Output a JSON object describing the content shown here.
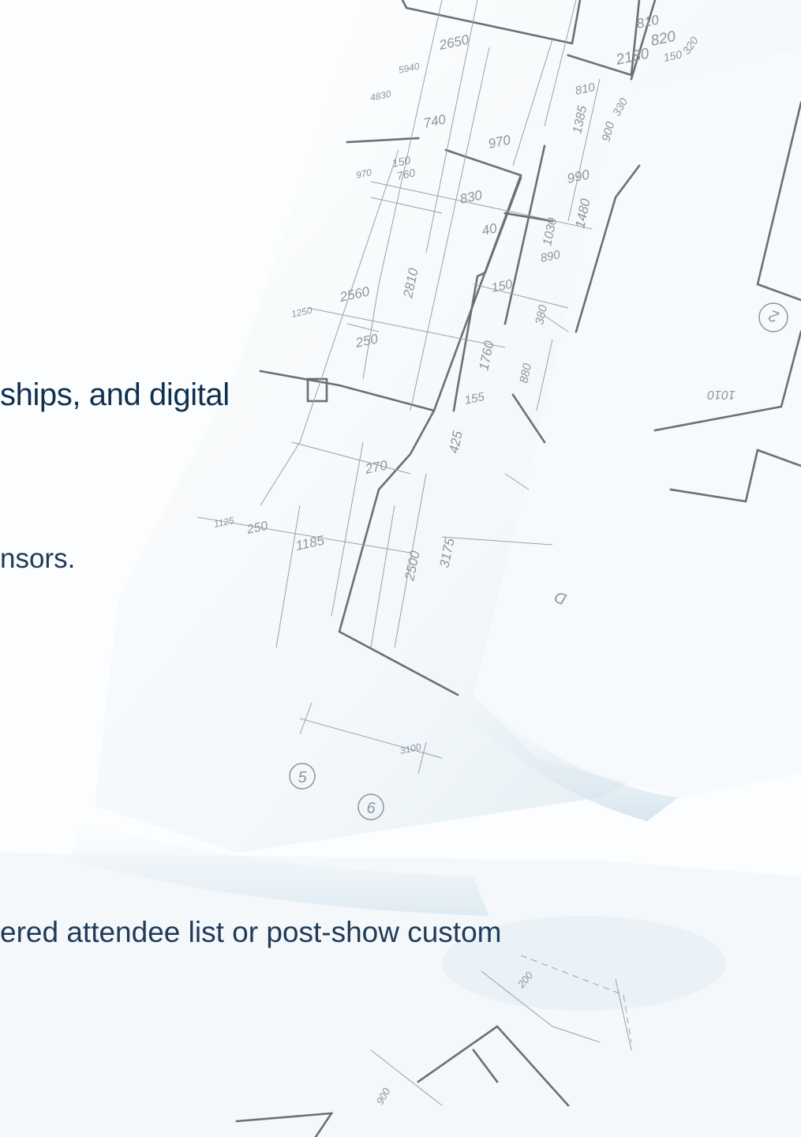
{
  "text": {
    "heading_fragment": "ships, and digital",
    "body_fragment_1": "nsors.",
    "body_fragment_2": "ered attendee list or post-show custom"
  },
  "drawing_labels": [
    "810",
    "820",
    "2180",
    "150",
    "320",
    "2650",
    "5940",
    "4830",
    "740",
    "970",
    "1385",
    "330",
    "900",
    "150",
    "760",
    "830",
    "990",
    "1480",
    "40",
    "1030",
    "890",
    "2810",
    "2560",
    "150",
    "1250",
    "250",
    "380",
    "1760",
    "880",
    "155",
    "425",
    "270",
    "1125",
    "250",
    "1185",
    "2500",
    "3175",
    "3100",
    "5",
    "6",
    "2",
    "1010",
    "D",
    "200",
    "900"
  ],
  "colors": {
    "heading": "#10304e",
    "body": "#1e3b58",
    "blueprint_line": "#6a7077"
  }
}
